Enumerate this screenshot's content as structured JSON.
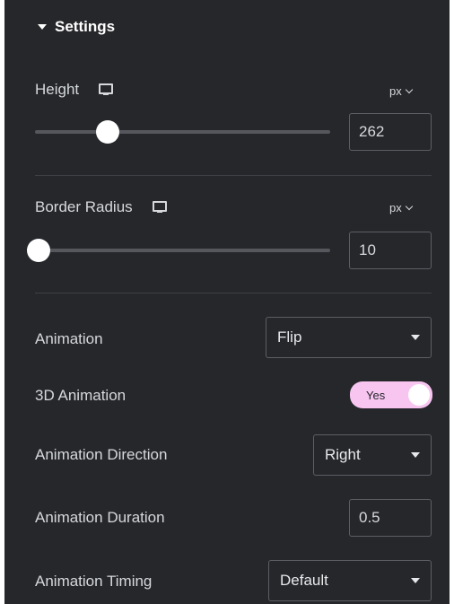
{
  "section": {
    "title": "Settings"
  },
  "height": {
    "label": "Height",
    "unit": "px",
    "value": "262",
    "device_icon": "monitor-icon"
  },
  "border_radius": {
    "label": "Border Radius",
    "unit": "px",
    "value": "10",
    "device_icon": "monitor-icon"
  },
  "animation": {
    "label": "Animation",
    "value": "Flip"
  },
  "animation_3d": {
    "label": "3D Animation",
    "state": "Yes"
  },
  "animation_direction": {
    "label": "Animation Direction",
    "value": "Right"
  },
  "animation_duration": {
    "label": "Animation Duration",
    "value": "0.5"
  },
  "animation_timing": {
    "label": "Animation Timing",
    "value": "Default"
  },
  "colors": {
    "panel": "#26272b",
    "toggle_on": "#f7c5f0",
    "text": "#d5d8dc"
  }
}
